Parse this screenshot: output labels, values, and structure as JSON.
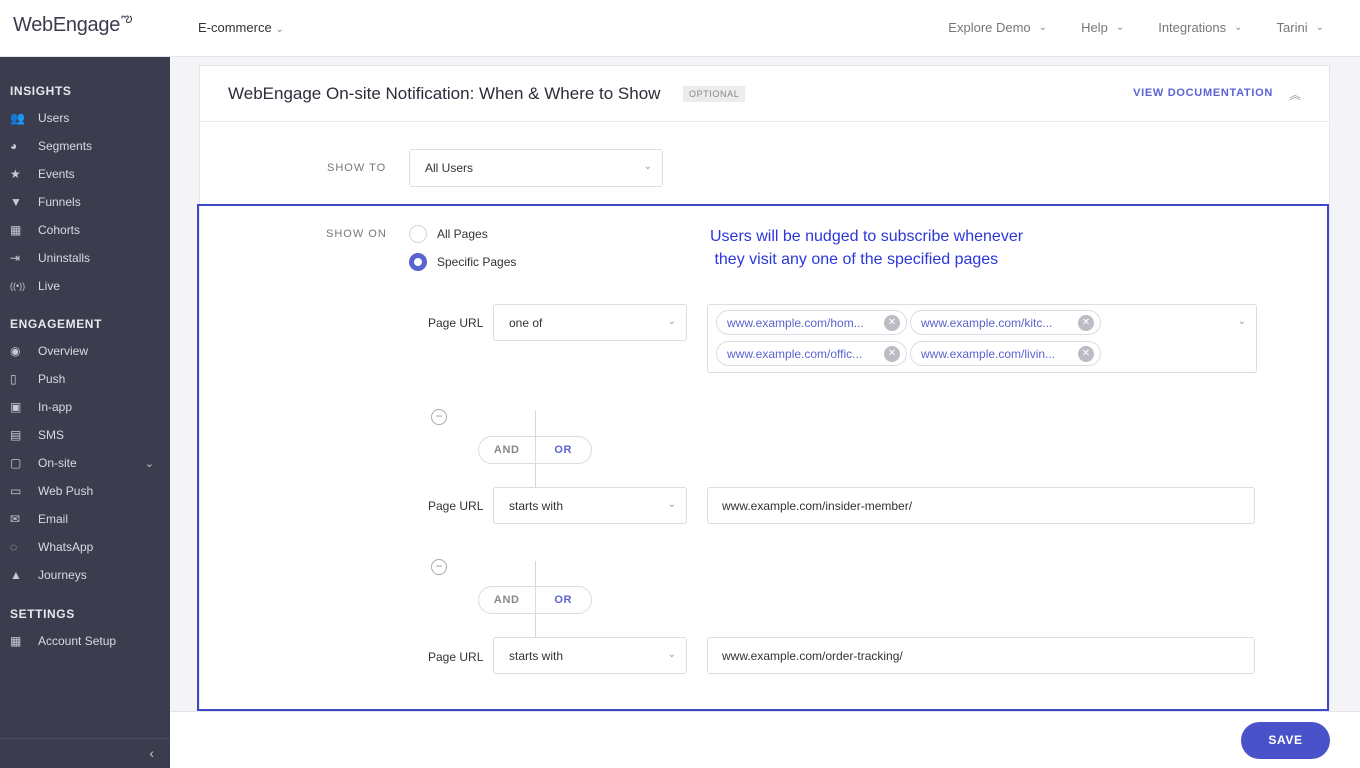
{
  "topbar": {
    "logo": "WebEngage",
    "project": "E-commerce",
    "nav": [
      {
        "label": "Explore Demo"
      },
      {
        "label": "Help"
      },
      {
        "label": "Integrations"
      },
      {
        "label": "Tarini"
      }
    ]
  },
  "sidebar": {
    "insights_title": "INSIGHTS",
    "insights": [
      {
        "label": "Users",
        "icon": "users-icon",
        "glyph": "👥"
      },
      {
        "label": "Segments",
        "icon": "pie-icon",
        "glyph": "◕"
      },
      {
        "label": "Events",
        "icon": "star-icon",
        "glyph": "★"
      },
      {
        "label": "Funnels",
        "icon": "funnel-icon",
        "glyph": "▼"
      },
      {
        "label": "Cohorts",
        "icon": "grid-icon",
        "glyph": "▦"
      },
      {
        "label": "Uninstalls",
        "icon": "exit-icon",
        "glyph": "⇥"
      },
      {
        "label": "Live",
        "icon": "broadcast-icon",
        "glyph": "((•))"
      }
    ],
    "engagement_title": "ENGAGEMENT",
    "engagement": [
      {
        "label": "Overview",
        "icon": "eye-icon",
        "glyph": "◉"
      },
      {
        "label": "Push",
        "icon": "mobile-push-icon",
        "glyph": "▯"
      },
      {
        "label": "In-app",
        "icon": "phone-icon",
        "glyph": "▣"
      },
      {
        "label": "SMS",
        "icon": "message-icon",
        "glyph": "▤"
      },
      {
        "label": "On-site",
        "icon": "onsite-icon",
        "glyph": "▢"
      },
      {
        "label": "Web Push",
        "icon": "web-push-icon",
        "glyph": "▭"
      },
      {
        "label": "Email",
        "icon": "email-icon",
        "glyph": "✉"
      },
      {
        "label": "WhatsApp",
        "icon": "whatsapp-icon",
        "glyph": "◌"
      },
      {
        "label": "Journeys",
        "icon": "rocket-icon",
        "glyph": "▲"
      }
    ],
    "settings_title": "SETTINGS",
    "settings": [
      {
        "label": "Account Setup",
        "icon": "dashboard-icon",
        "glyph": "▦"
      }
    ]
  },
  "card": {
    "title": "WebEngage On-site Notification: When & Where to Show",
    "badge": "OPTIONAL",
    "view_doc": "VIEW DOCUMENTATION"
  },
  "show_to": {
    "label": "SHOW TO",
    "value": "All Users"
  },
  "show_on": {
    "label": "SHOW ON",
    "options": [
      {
        "label": "All Pages",
        "selected": false
      },
      {
        "label": "Specific Pages",
        "selected": true
      }
    ]
  },
  "note": {
    "line1": "Users will be nudged to subscribe whenever",
    "line2": " they visit any one of the specified pages"
  },
  "rules": [
    {
      "label": "Page URL",
      "operator": "one of",
      "tags": [
        "www.example.com/hom...",
        "www.example.com/kitc...",
        "www.example.com/offic...",
        "www.example.com/livin..."
      ]
    },
    {
      "label": "Page URL",
      "operator": "starts with",
      "value": "www.example.com/insider-member/"
    },
    {
      "label": "Page URL",
      "operator": "starts with",
      "value": "www.example.com/order-tracking/"
    }
  ],
  "connectors": [
    {
      "and": "AND",
      "or": "OR",
      "selected": "OR"
    },
    {
      "and": "AND",
      "or": "OR",
      "selected": "OR"
    }
  ],
  "footer": {
    "save": "SAVE"
  },
  "colors": {
    "accent": "#5a63d0",
    "sidebar": "#3b3d4f",
    "highlight": "#3f49c8",
    "save_button": "#4a52c9"
  }
}
